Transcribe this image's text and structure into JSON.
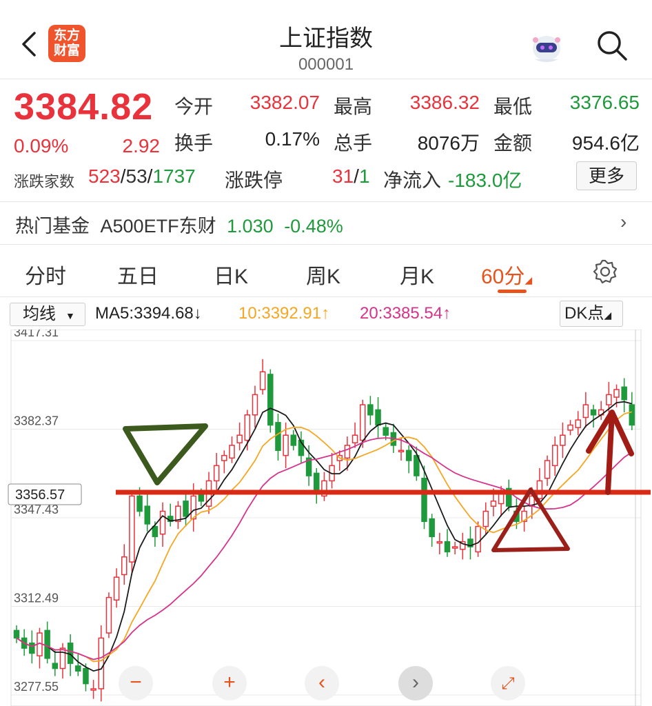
{
  "header": {
    "title": "上证指数",
    "code": "000001",
    "logo_text_line1": "东方",
    "logo_text_line2": "财富",
    "icons": [
      "back-chevron-icon",
      "robot-assistant-icon",
      "search-icon"
    ]
  },
  "quote": {
    "price": "3384.82",
    "change_pct": "0.09%",
    "change": "2.92",
    "rows": [
      [
        {
          "label": "今开",
          "value": "3382.07",
          "color": "red"
        },
        {
          "label": "最高",
          "value": "3386.32",
          "color": "red"
        },
        {
          "label": "最低",
          "value": "3376.65",
          "color": "green"
        }
      ],
      [
        {
          "label": "换手",
          "value": "0.17%",
          "color": "gray"
        },
        {
          "label": "总手",
          "value": "8076万",
          "color": "gray"
        },
        {
          "label": "金额",
          "value": "954.6亿",
          "color": "gray"
        }
      ]
    ],
    "breadth_label": "涨跌家数",
    "breadth_up": "523",
    "breadth_flat": "53",
    "breadth_down": "1737",
    "limit_label": "涨跌停",
    "limit_up": "31",
    "limit_down": "1",
    "netflow_label": "净流入",
    "netflow_value": "-183.0亿",
    "more_button": "更多"
  },
  "fund": {
    "label": "热门基金",
    "name": "A500ETF东财",
    "price": "1.030",
    "change": "-0.48%"
  },
  "tabs": [
    {
      "label": "分时",
      "active": false
    },
    {
      "label": "五日",
      "active": false
    },
    {
      "label": "日K",
      "active": false
    },
    {
      "label": "周K",
      "active": false
    },
    {
      "label": "月K",
      "active": false
    },
    {
      "label": "60分",
      "active": true
    }
  ],
  "ma_bar": {
    "selector": "均线",
    "ma5": "MA5:3394.68↓",
    "ma10": "10:3392.91↑",
    "ma20": "20:3385.54↑",
    "dk_button": "DK点"
  },
  "chart_data": {
    "type": "candlestick",
    "y_ticks": [
      "3417.31",
      "3382.37",
      "3347.43",
      "3312.49",
      "3277.55"
    ],
    "price_label": "3356.57",
    "ylim": [
      3277.55,
      3417.31
    ],
    "closes": [
      3300,
      3296,
      3294,
      3302,
      3292,
      3288,
      3296,
      3290,
      3287,
      3282,
      3280,
      3300,
      3316,
      3324,
      3332,
      3356,
      3350,
      3345,
      3340,
      3350,
      3346,
      3352,
      3348,
      3356,
      3354,
      3362,
      3368,
      3372,
      3376,
      3380,
      3388,
      3396,
      3405,
      3384,
      3374,
      3380,
      3376,
      3372,
      3364,
      3358,
      3362,
      3368,
      3372,
      3376,
      3380,
      3392,
      3388,
      3384,
      3380,
      3376,
      3374,
      3370,
      3364,
      3346,
      3340,
      3338,
      3334,
      3336,
      3338,
      3336,
      3344,
      3350,
      3354,
      3358,
      3352,
      3346,
      3350,
      3356,
      3362,
      3370,
      3376,
      3380,
      3384,
      3386,
      3392,
      3388,
      3390,
      3396,
      3398,
      3394,
      3384
    ],
    "colors": {
      "up": "#e8323c",
      "down": "#1e9a3c",
      "ma5": "#1a1a1a",
      "ma10": "#f5a623",
      "ma20": "#d6338a"
    },
    "controls": [
      "minus-icon",
      "plus-icon",
      "scroll-left-icon",
      "scroll-right-icon",
      "fullscreen-icon"
    ]
  }
}
